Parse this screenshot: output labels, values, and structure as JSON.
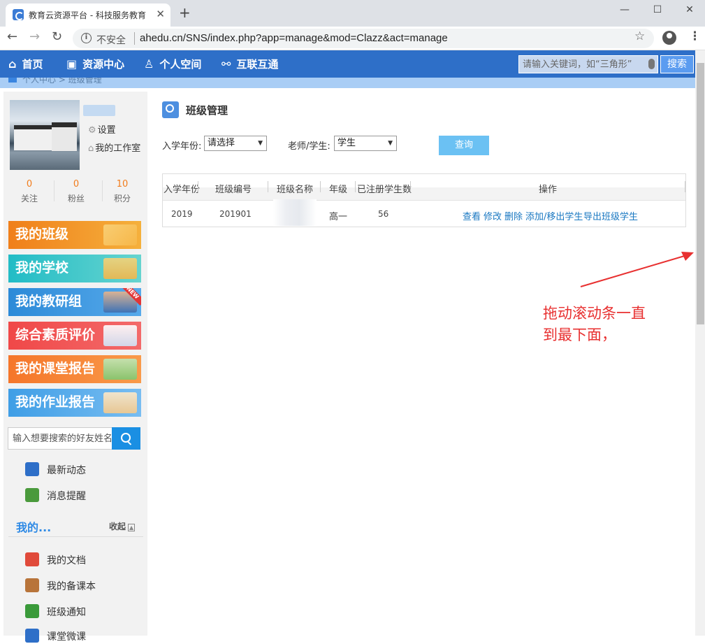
{
  "browser": {
    "tab_title": "教育云资源平台 - 科技服务教育",
    "close_glyph": "✕",
    "new_tab_glyph": "+",
    "insecure_label": "不安全",
    "url": "ahedu.cn/SNS/index.php?app=manage&mod=Clazz&act=manage",
    "window_controls": [
      "—",
      "☐",
      "✕"
    ],
    "nav": {
      "back": "←",
      "forward": "→",
      "reload": "↻"
    }
  },
  "site_nav": {
    "items": [
      {
        "label": "首页",
        "icon": "home-icon"
      },
      {
        "label": "资源中心",
        "icon": "briefcase-icon"
      },
      {
        "label": "个人空间",
        "icon": "user-icon"
      },
      {
        "label": "互联互通",
        "icon": "link-icon"
      }
    ],
    "search_placeholder": "请输入关键词，如“三角形”",
    "search_button": "搜索"
  },
  "breadcrumb": "个人中心 > 班级管理",
  "profile": {
    "settings_label": "设置",
    "workspace_label": "我的工作室",
    "stats": [
      {
        "value": "0",
        "label": "关注"
      },
      {
        "value": "0",
        "label": "粉丝"
      },
      {
        "value": "10",
        "label": "积分"
      }
    ]
  },
  "banners": [
    {
      "label": "我的班级",
      "color": "#f08c1c"
    },
    {
      "label": "我的学校",
      "color": "#27c2c8"
    },
    {
      "label": "我的教研组",
      "color": "#2b8fd9"
    },
    {
      "label": "综合素质评价",
      "color": "#f04e4e"
    },
    {
      "label": "我的课堂报告",
      "color": "#f5822e"
    },
    {
      "label": "我的作业报告",
      "color": "#4aa3e8"
    }
  ],
  "new_badge": "NEW",
  "friend_search_placeholder": "输入想要搜索的好友姓名",
  "menu": {
    "items": [
      {
        "label": "最新动态",
        "color": "#2e6fc8"
      },
      {
        "label": "消息提醒",
        "color": "#4a9a3c"
      }
    ],
    "my_section_title": "我的...",
    "collapse_label": "收起",
    "my_items": [
      {
        "label": "我的文档",
        "color": "#e04a3a"
      },
      {
        "label": "我的备课本",
        "color": "#b8743a"
      },
      {
        "label": "班级通知",
        "color": "#3a9a3a"
      },
      {
        "label": "课堂微课",
        "color": "#2e6fc8"
      }
    ]
  },
  "main": {
    "title": "班级管理",
    "filters": {
      "year_label": "入学年份:",
      "year_value": "请选择",
      "role_label": "老师/学生:",
      "role_value": "学生",
      "query_button": "查询"
    },
    "table": {
      "headers": [
        "入学年份",
        "班级编号",
        "班级名称",
        "年级",
        "已注册学生数",
        "操作"
      ],
      "rows": [
        {
          "year": "2019",
          "code": "201901",
          "name": "",
          "grade": "高一",
          "count": "56",
          "actions": [
            "查看",
            "修改",
            "删除",
            "添加/移出学生",
            "导出班级学生"
          ]
        }
      ]
    }
  },
  "annotation": {
    "line1": "拖动滚动条一直",
    "line2": "到最下面，",
    "color": "#e83030"
  }
}
